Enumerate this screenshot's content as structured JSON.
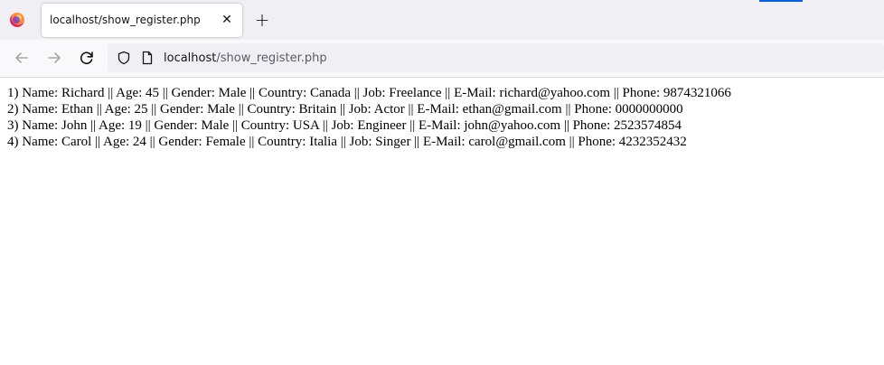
{
  "browser": {
    "tab": {
      "title": "localhost/show_register.php",
      "close_glyph": "✕"
    },
    "new_tab_glyph": "+",
    "url": {
      "host": "localhost",
      "path": "/show_register.php"
    },
    "icons": {
      "logo": "firefox-logo-icon",
      "back": "arrow-left-icon",
      "forward": "arrow-right-icon",
      "reload": "reload-icon",
      "shield": "shield-icon",
      "page": "page-icon"
    },
    "colors": {
      "tabstrip": "#f0f0f4",
      "toolbar": "#f9f9fb",
      "urlbar": "#f0f0f4",
      "accent": "#0061e0"
    }
  },
  "page": {
    "records": [
      "1) Name: Richard || Age: 45 || Gender: Male || Country: Canada || Job: Freelance || E-Mail: richard@yahoo.com || Phone: 9874321066",
      "2) Name: Ethan || Age: 25 || Gender: Male || Country: Britain || Job: Actor || E-Mail: ethan@gmail.com || Phone: 0000000000",
      "3) Name: John || Age: 19 || Gender: Male || Country: USA || Job: Engineer || E-Mail: john@yahoo.com || Phone: 2523574854",
      "4) Name: Carol || Age: 24 || Gender: Female || Country: Italia || Job: Singer || E-Mail: carol@gmail.com || Phone: 4232352432"
    ]
  }
}
